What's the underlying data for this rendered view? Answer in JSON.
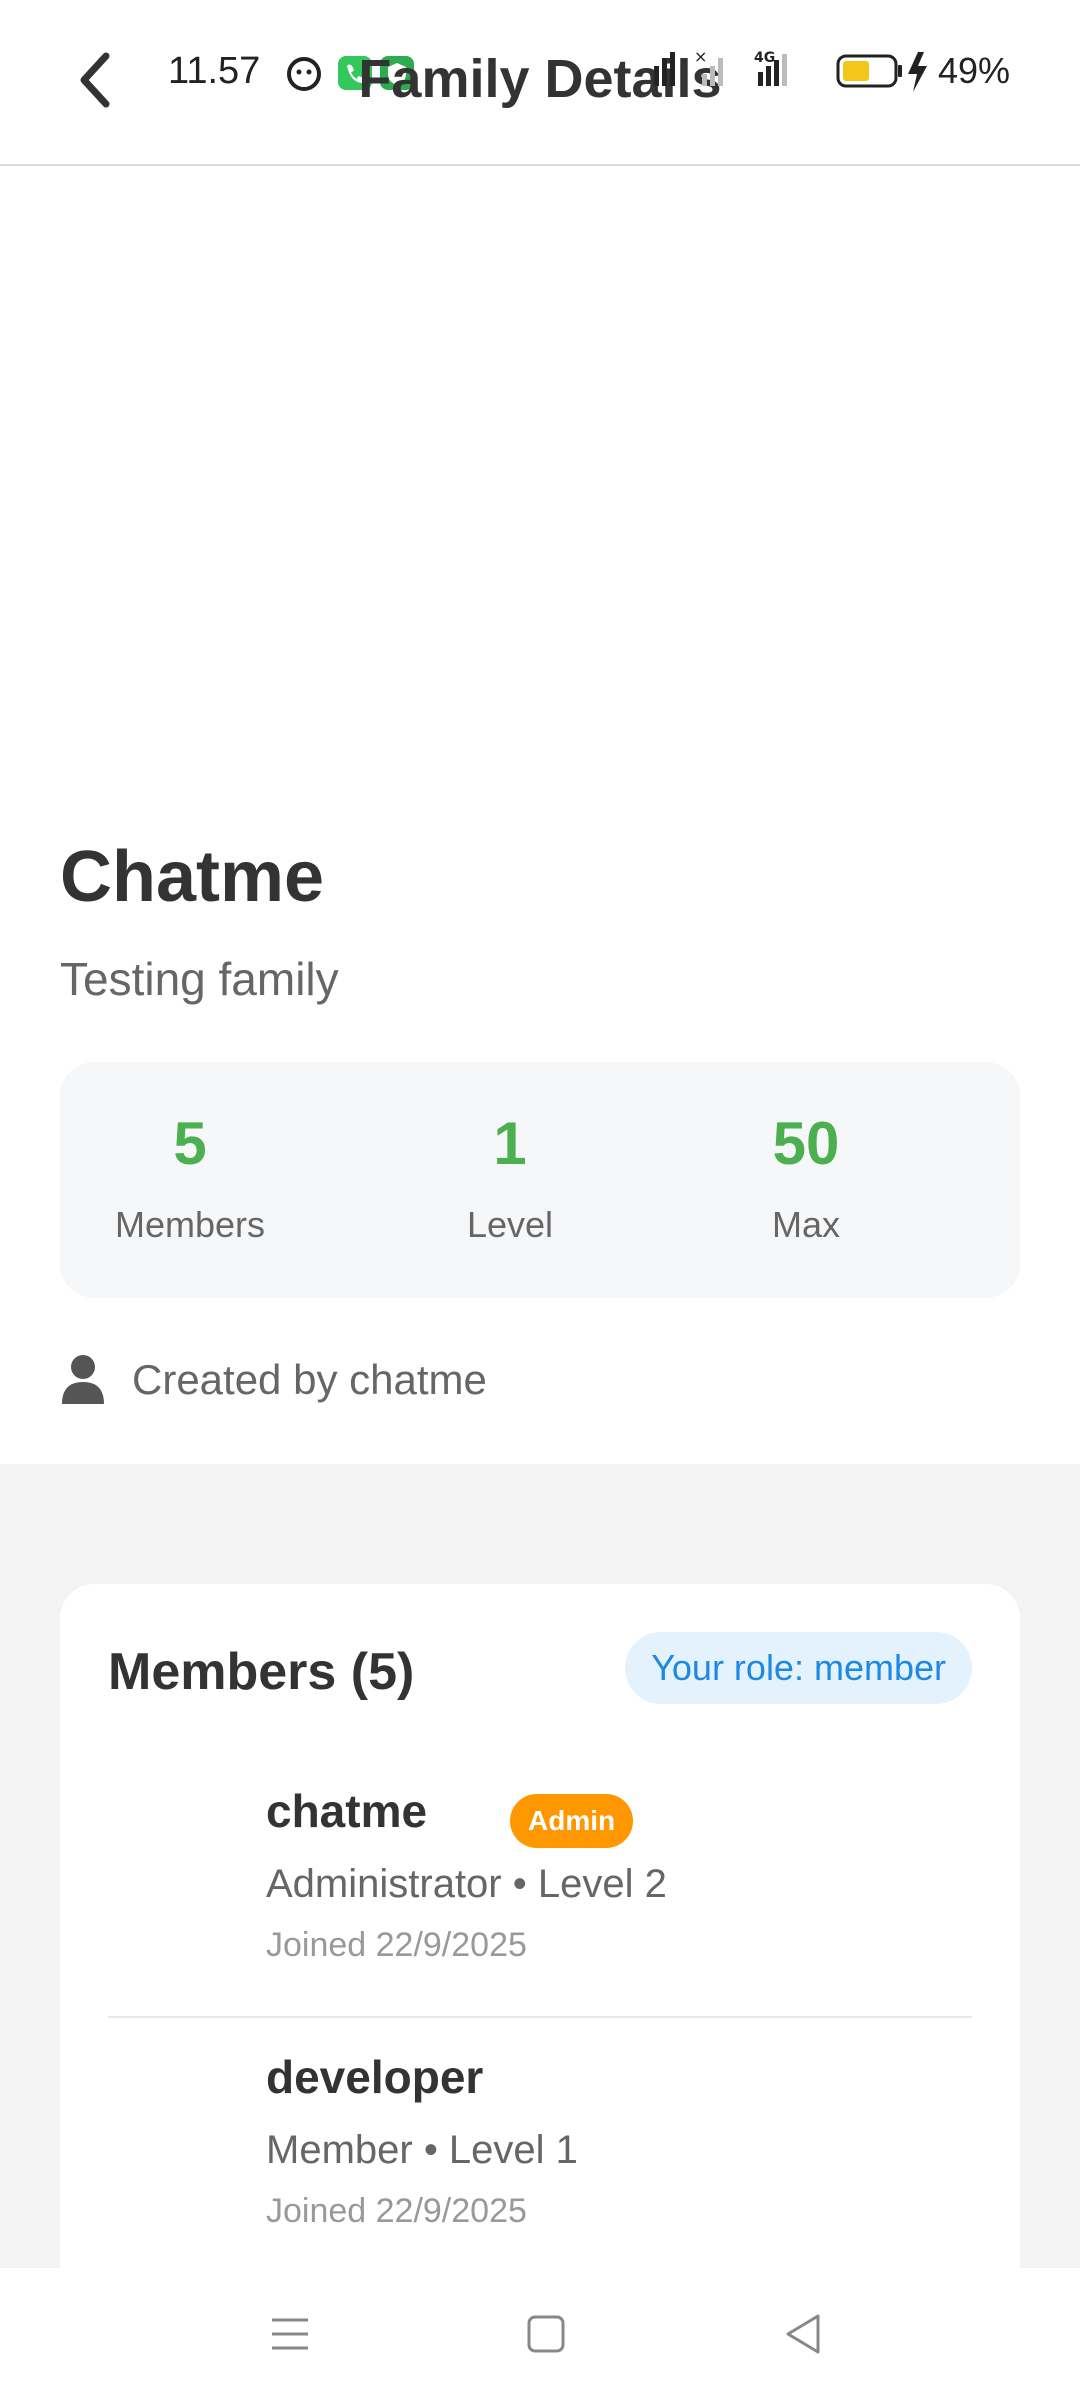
{
  "status_bar": {
    "time": "11.57",
    "battery": "49%",
    "network": "4G"
  },
  "header": {
    "title": "Family Details",
    "back_icon": "chevron-left-icon"
  },
  "family": {
    "name": "Chatme",
    "description": "Testing family",
    "created_by": "Created by chatme"
  },
  "stats": [
    {
      "value": "5",
      "label": "Members"
    },
    {
      "value": "1",
      "label": "Level"
    },
    {
      "value": "50",
      "label": "Max"
    }
  ],
  "members_section": {
    "title": "Members (5)",
    "role_badge": "Your role: member",
    "items": [
      {
        "name": "chatme",
        "badge": "Admin",
        "subtitle": "Administrator • Level 2",
        "joined": "Joined 22/9/2025"
      },
      {
        "name": "developer",
        "subtitle": "Member • Level 1",
        "joined": "Joined 22/9/2025"
      }
    ]
  },
  "colors": {
    "accent_green": "#4caf50",
    "admin_orange": "#ff9800",
    "role_blue": "#1e88e5",
    "role_blue_bg": "#e3f2fd"
  }
}
